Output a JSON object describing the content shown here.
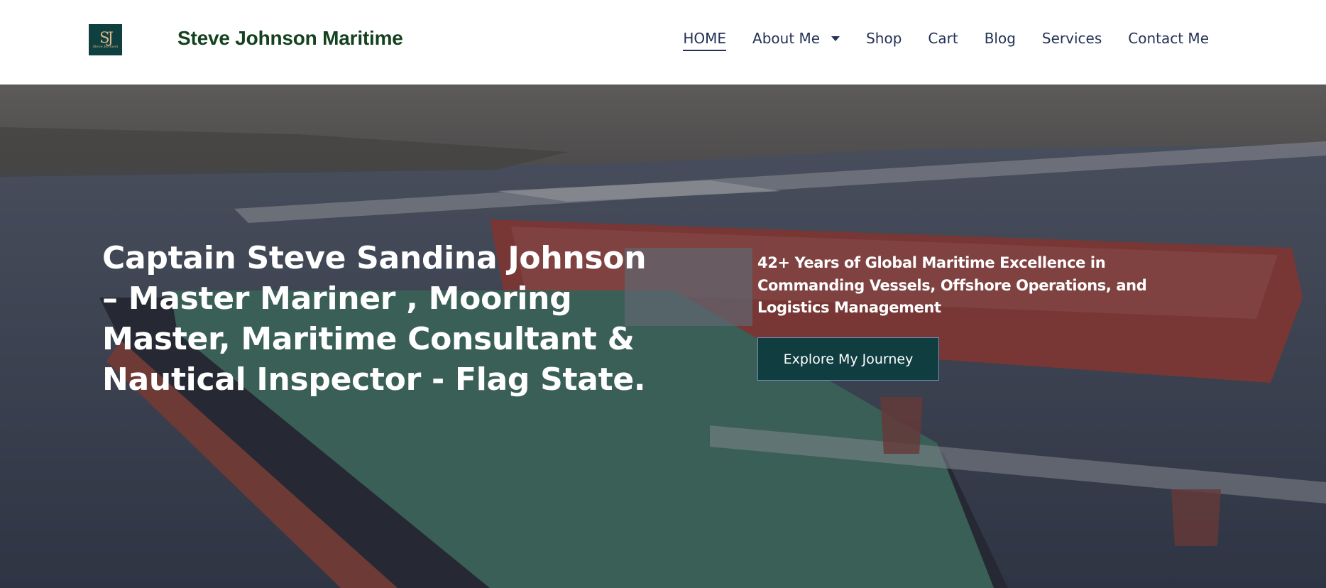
{
  "header": {
    "logo": {
      "monogram": "SJ",
      "signature": "Steve Johnson"
    },
    "site_title": "Steve Johnson Maritime",
    "nav": {
      "home": "HOME",
      "about": "About Me",
      "shop": "Shop",
      "cart": "Cart",
      "blog": "Blog",
      "services": "Services",
      "contact": "Contact Me"
    }
  },
  "hero": {
    "heading": "Captain Steve Sandina Johnson – Master Mariner , Mooring Master, Maritime Consultant & Nautical Inspector - Flag State.",
    "tagline": "42+ Years of Global Maritime Excellence in Commanding Vessels, Offshore Operations, and Logistics Management",
    "cta_label": "Explore My Journey"
  },
  "colors": {
    "brand_green": "#14421f",
    "logo_bg": "#0f3f3e",
    "nav_text": "#223155",
    "cta_bg": "#0f3d40"
  }
}
